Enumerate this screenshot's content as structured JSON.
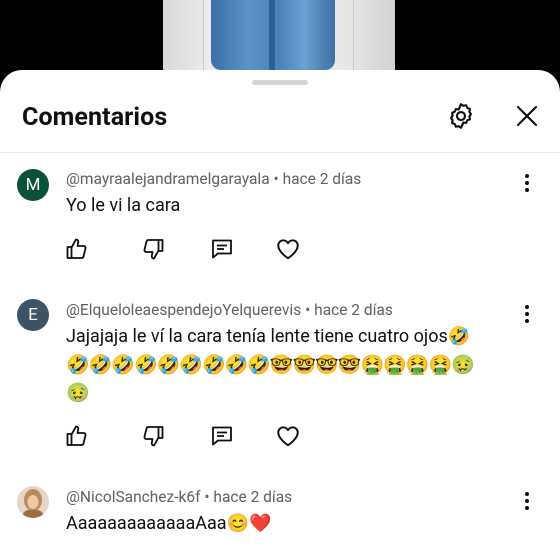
{
  "sheet": {
    "title": "Comentarios"
  },
  "comments": [
    {
      "author": "@mayraalejandramelgarayala",
      "time": "hace 2 días",
      "avatar_letter": "M",
      "avatar_color": "#0b5138",
      "text_lines": [
        "Yo le vi la cara"
      ]
    },
    {
      "author": "@ElqueloleaespendejoYelquerevis",
      "time": "hace 2 días",
      "avatar_letter": "E",
      "avatar_color": "#3d5466",
      "text_lines": [
        "Jajajaja le ví la cara tenía lente tiene cuatro ojos🤣",
        "🤣🤣🤣🤣🤣🤣🤣🤣🤣🤓🤓🤓🤓🤮🤮🤮🤮🤢",
        "🤢"
      ]
    },
    {
      "author": "@NicolSanchez-k6f",
      "time": "hace 2 días",
      "avatar_letter": "",
      "avatar_color": "#c9a27a",
      "text_lines": [
        "AaaaaaaaaaaaaAaa😊❤️"
      ]
    }
  ],
  "separator": "•",
  "icons": {
    "settings": "gear-icon",
    "close": "close-icon",
    "like": "thumbs-up-icon",
    "dislike": "thumbs-down-icon",
    "reply": "reply-icon",
    "heart": "heart-icon",
    "more": "more-vertical-icon"
  },
  "colors": {
    "text": "#0f0f0f",
    "meta": "#606060",
    "divider": "#e5e5e5"
  }
}
